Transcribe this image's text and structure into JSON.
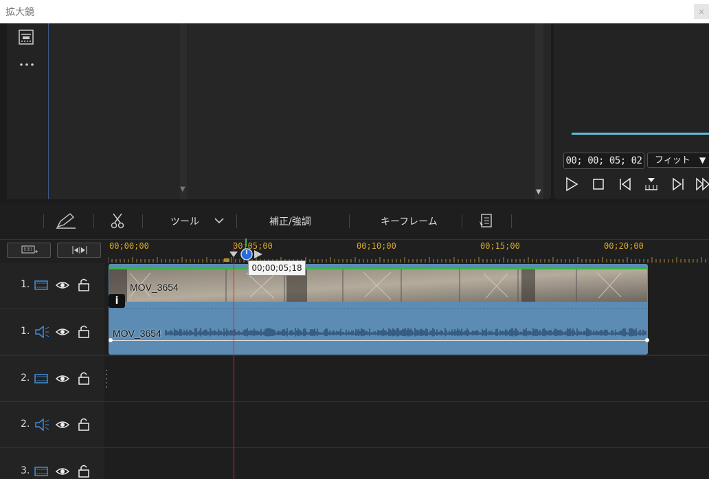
{
  "window": {
    "title": "拡大鏡",
    "close": "×"
  },
  "preview": {
    "timecode": "00; 00; 05; 02",
    "fit": "フィット"
  },
  "toolbar": {
    "tools_label": "ツール",
    "correct_label": "補正/強調",
    "keyframe_label": "キーフレーム"
  },
  "ruler": {
    "labels": [
      "00;00;00",
      "00;05;00",
      "00;10;00",
      "00;15;00",
      "00;20;00"
    ],
    "tooltip": "00;00;05;18"
  },
  "tracks": [
    {
      "number": "1.",
      "type": "video"
    },
    {
      "number": "1.",
      "type": "audio"
    },
    {
      "number": "2.",
      "type": "video"
    },
    {
      "number": "2.",
      "type": "audio"
    },
    {
      "number": "3.",
      "type": "video"
    }
  ],
  "clip": {
    "video_name": "MOV_3654",
    "audio_name": "MOV_3654",
    "badge": "i"
  },
  "colors": {
    "accent_blue": "#5bc0de",
    "ruler_label": "#d4a82c",
    "playhead": "#e02020",
    "clip_fill": "#5c8cb4",
    "track_icon": "#3d8fe0"
  }
}
